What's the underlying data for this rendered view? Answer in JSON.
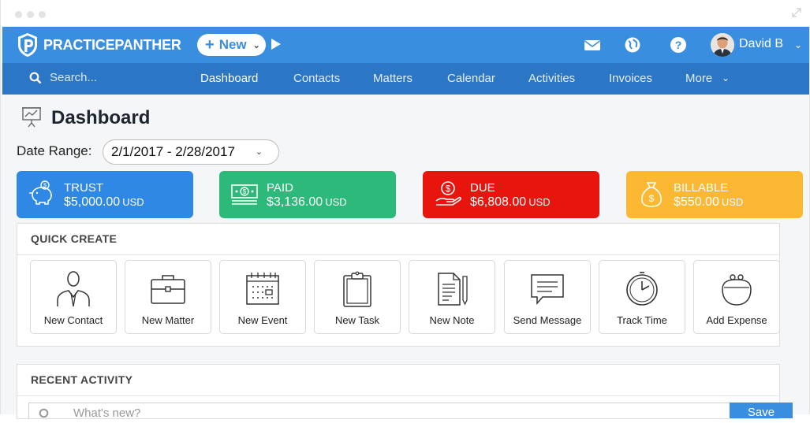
{
  "app": {
    "logo_text": "PRACTICEPANTHER"
  },
  "topbar": {
    "new_label": "New",
    "user_name": "David B"
  },
  "navbar": {
    "search_placeholder": "Search...",
    "items": [
      "Dashboard",
      "Contacts",
      "Matters",
      "Calendar",
      "Activities",
      "Invoices",
      "More"
    ]
  },
  "page": {
    "title": "Dashboard",
    "date_range_label": "Date Range:",
    "date_range_value": "2/1/2017 - 2/28/2017"
  },
  "cards": [
    {
      "label": "TRUST",
      "value": "$5,000.00",
      "currency": "USD",
      "color": "#2f88e3",
      "icon": "piggy-bank-icon"
    },
    {
      "label": "PAID",
      "value": "$3,136.00",
      "currency": "USD",
      "color": "#2db979",
      "icon": "cash-icon"
    },
    {
      "label": "DUE",
      "value": "$6,808.00",
      "currency": "USD",
      "color": "#e8150f",
      "icon": "hand-dollar-icon"
    },
    {
      "label": "BILLABLE",
      "value": "$550.00",
      "currency": "USD",
      "color": "#fcb833",
      "icon": "money-bag-icon"
    }
  ],
  "quick_create": {
    "title": "QUICK CREATE",
    "items": [
      {
        "label": "New Contact",
        "icon": "person-icon"
      },
      {
        "label": "New Matter",
        "icon": "briefcase-icon"
      },
      {
        "label": "New Event",
        "icon": "calendar-icon"
      },
      {
        "label": "New Task",
        "icon": "clipboard-icon"
      },
      {
        "label": "New Note",
        "icon": "note-icon"
      },
      {
        "label": "Send Message",
        "icon": "message-icon"
      },
      {
        "label": "Track Time",
        "icon": "clock-icon"
      },
      {
        "label": "Add Expense",
        "icon": "purse-icon"
      }
    ]
  },
  "recent_activity": {
    "title": "RECENT ACTIVITY",
    "input_placeholder": "What's new?",
    "save_label": "Save"
  }
}
